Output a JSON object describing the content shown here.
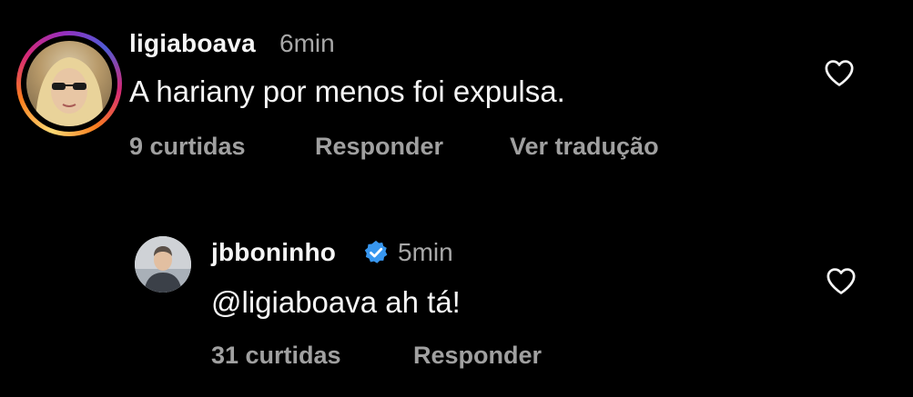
{
  "comments": [
    {
      "username": "ligiaboava",
      "time": "6min",
      "text": "A hariany por menos foi expulsa.",
      "likes": "9 curtidas",
      "reply": "Responder",
      "translate": "Ver tradução",
      "verified": false,
      "has_story_ring": true
    },
    {
      "username": "jbboninho",
      "time": "5min",
      "text": "@ligiaboava ah tá!",
      "likes": "31 curtidas",
      "reply": "Responder",
      "verified": true,
      "has_story_ring": false
    }
  ],
  "colors": {
    "background": "#000000",
    "primary_text": "#f5f5f5",
    "secondary_text": "#a0a0a0",
    "verified_blue": "#3897f0"
  }
}
